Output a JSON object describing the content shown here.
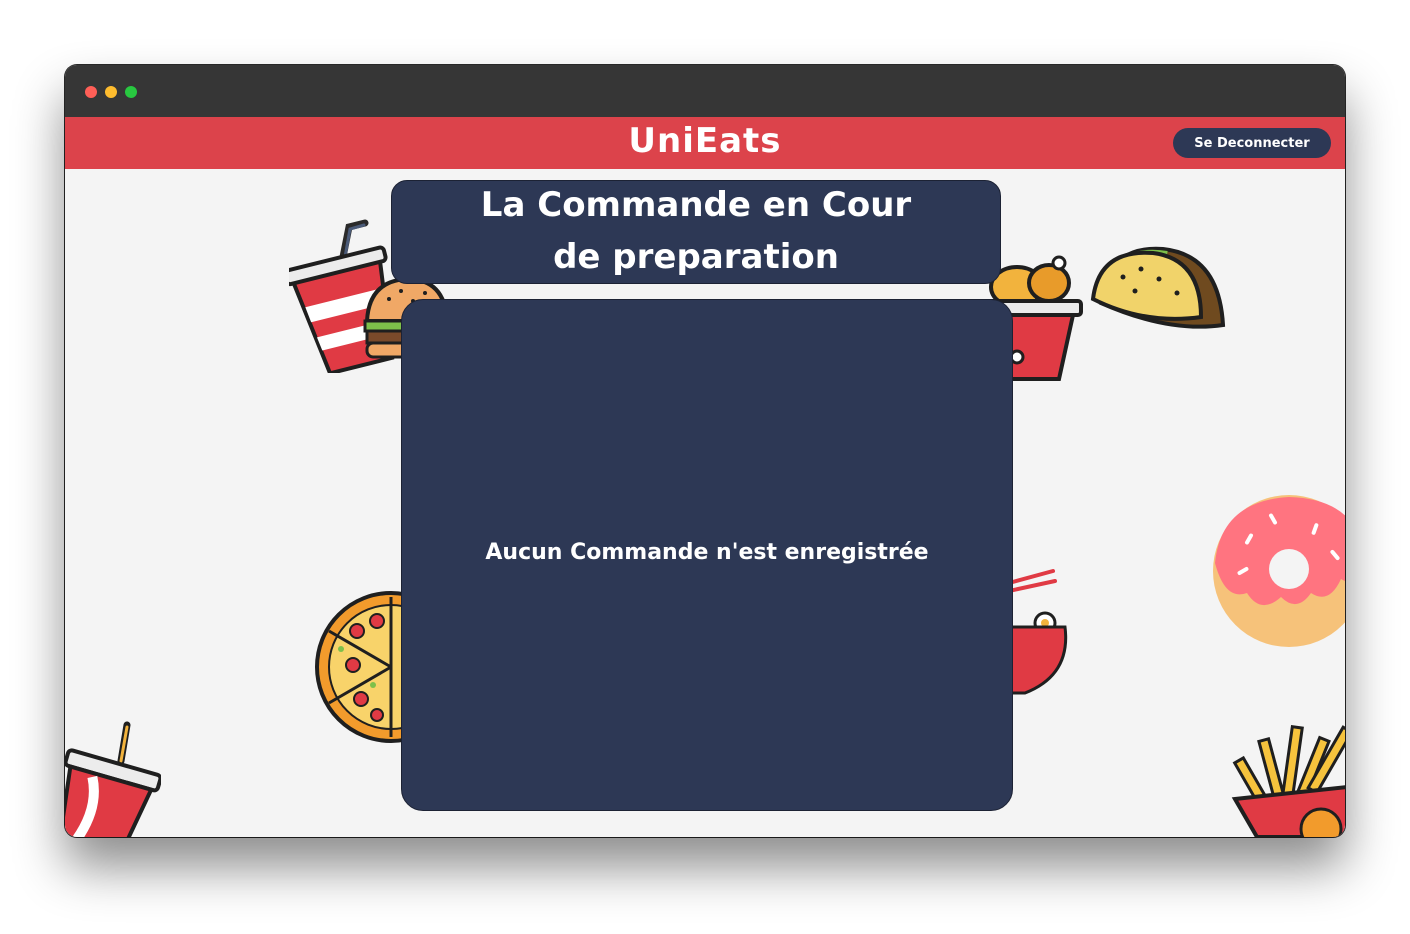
{
  "colors": {
    "titlebar": "#363636",
    "dot_red": "#ff5f57",
    "dot_yellow": "#febc2e",
    "dot_green": "#28c840",
    "header": "#dc434b",
    "panel": "#2d3855",
    "button": "#2d3855"
  },
  "header": {
    "brand": "UniEats",
    "logout_label": "Se Deconnecter"
  },
  "main": {
    "title_line1": "La Commande en Cour",
    "title_line2": "de preparation",
    "empty_message": "Aucun Commande n'est enregistrée"
  },
  "decorations": [
    "soda-burger-icon",
    "fried-chicken-icon",
    "taco-icon",
    "donut-icon",
    "noodles-icon",
    "pizza-icon",
    "drink-cup-icon",
    "fries-icon"
  ]
}
